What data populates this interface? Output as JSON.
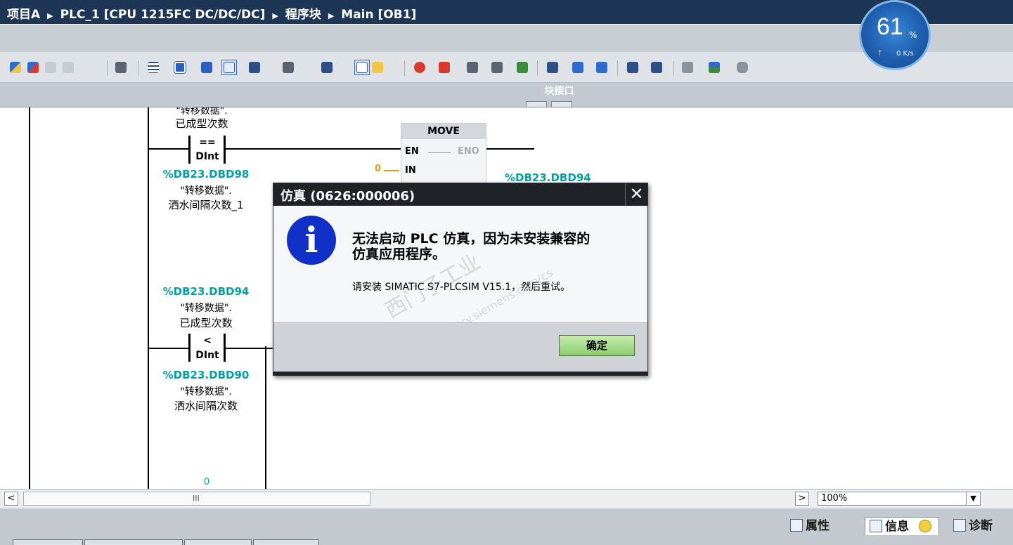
{
  "titlebar": {
    "crumbs": [
      "项目A",
      "PLC_1 [CPU 1215FC DC/DC/DC]",
      "程序块",
      "Main [OB1]"
    ]
  },
  "monitor": {
    "cpu_percent": "61",
    "unit": "%",
    "net_speed": "0 K/s"
  },
  "interface_bar": {
    "label": "块接口"
  },
  "ladder": {
    "top_operand_label_partial": "\"转移数据\".",
    "top_operand_name": "已成型次数",
    "cmp1": {
      "op": "==",
      "type": "DInt",
      "operand2": "%DB23.DBD98",
      "operand2_db": "\"转移数据\".",
      "operand2_name": "洒水间隔次数_1"
    },
    "move": {
      "title": "MOVE",
      "en": "EN",
      "eno": "ENO",
      "in": "IN",
      "in_value": "0",
      "out_operand": "%DB23.DBD94"
    },
    "cmp2": {
      "operand1": "%DB23.DBD94",
      "operand1_db": "\"转移数据\".",
      "operand1_name": "已成型次数",
      "op": "<",
      "type": "DInt",
      "operand2": "%DB23.DBD90",
      "operand2_db": "\"转移数据\".",
      "operand2_name": "洒水间隔次数"
    },
    "bottom_value": "0"
  },
  "dialog": {
    "title": "仿真 (0626:000006)",
    "close": "✕",
    "icon_letter": "i",
    "message_line1": "无法启动 PLC 仿真，因为未安装兼容的",
    "message_line2": "仿真应用程序。",
    "sub_message": "请安装 SIMATIC S7-PLCSIM V15.1，然后重试。",
    "ok_label": "确定",
    "watermark1": "西门子工业",
    "watermark2": "support.industry.siemens.com/cs"
  },
  "scroll": {
    "left_arrow": "<",
    "right_arrow": ">",
    "grip": "III",
    "zoom_value": "100%",
    "zoom_arrow": "▼"
  },
  "status_tabs": {
    "properties": "属性",
    "info": "信息",
    "diagnostics": "诊断"
  },
  "colors": {
    "operand_teal": "#00a0a8",
    "titlebar": "#1e3656",
    "dialog_title": "#1f2327",
    "ok_green": "#8ecb6d",
    "info_blue": "#1130c8"
  }
}
